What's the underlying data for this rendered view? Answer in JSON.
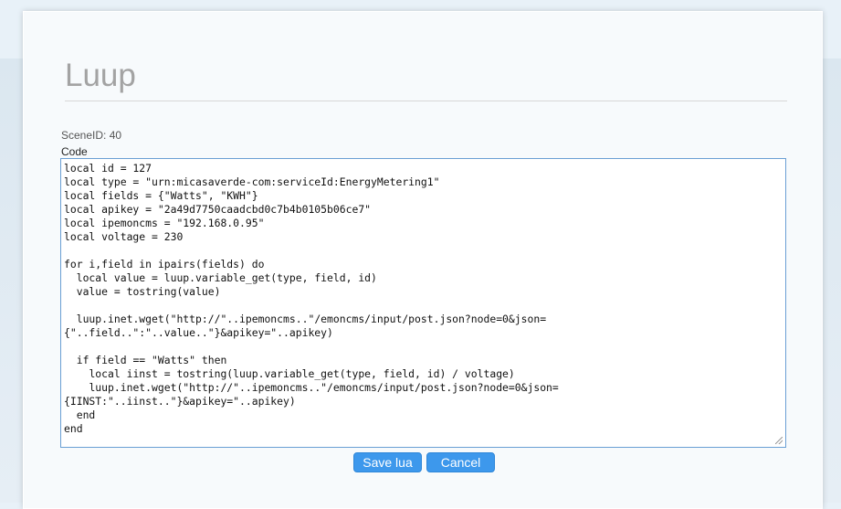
{
  "dialog": {
    "title": "Luup",
    "scene_id_text": "SceneID: 40",
    "code_label": "Code",
    "code": "local id = 127\nlocal type = \"urn:micasaverde-com:serviceId:EnergyMetering1\"\nlocal fields = {\"Watts\", \"KWH\"}\nlocal apikey = \"2a49d7750caadcbd0c7b4b0105b06ce7\"\nlocal ipemoncms = \"192.168.0.95\"\nlocal voltage = 230\n\nfor i,field in ipairs(fields) do\n  local value = luup.variable_get(type, field, id)\n  value = tostring(value)\n\n  luup.inet.wget(\"http://\"..ipemoncms..\"/emoncms/input/post.json?node=0&json=\n{\"..field..\":\"..value..\"}&apikey=\"..apikey)\n\n  if field == \"Watts\" then\n    local iinst = tostring(luup.variable_get(type, field, id) / voltage)\n    luup.inet.wget(\"http://\"..ipemoncms..\"/emoncms/input/post.json?node=0&json=\n{IINST:\"..iinst..\"}&apikey=\"..apikey)\n  end\nend",
    "save_label": "Save lua",
    "cancel_label": "Cancel"
  },
  "colors": {
    "accent": "#3d98ec",
    "focus_border": "#6a9fd4",
    "title_color": "#a3a3a3"
  }
}
